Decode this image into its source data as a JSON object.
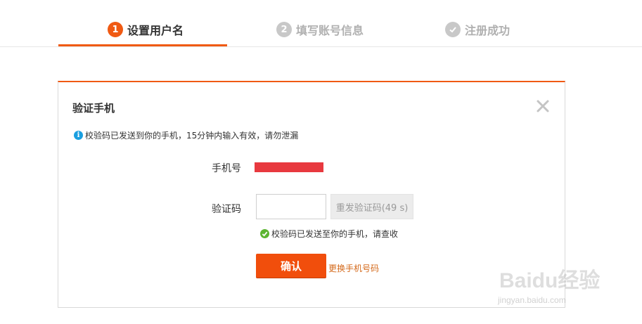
{
  "steps": [
    {
      "number": "1",
      "label": "设置用户名",
      "state": "active"
    },
    {
      "number": "2",
      "label": "填写账号信息",
      "state": "inactive"
    },
    {
      "number": "",
      "label": "注册成功",
      "state": "done"
    }
  ],
  "dialog": {
    "title": "验证手机",
    "notice": "校验码已发送到你的手机，15分钟内输入有效，请勿泄漏",
    "phone_label": "手机号",
    "code_label": "验证码",
    "code_input_value": "",
    "resend_label": "重发验证码(49 s)",
    "sent_message": "校验码已发送至你的手机，请查收",
    "confirm_label": "确认",
    "change_phone_label": "更换手机号码"
  },
  "watermark": {
    "text": "Baidu经验",
    "sub": "jingyan.baidu.com"
  },
  "colors": {
    "accent": "#f05a13",
    "masked_phone": "#e8393f",
    "info": "#1a9fe0",
    "success": "#5cb531",
    "link": "#d4691a"
  }
}
